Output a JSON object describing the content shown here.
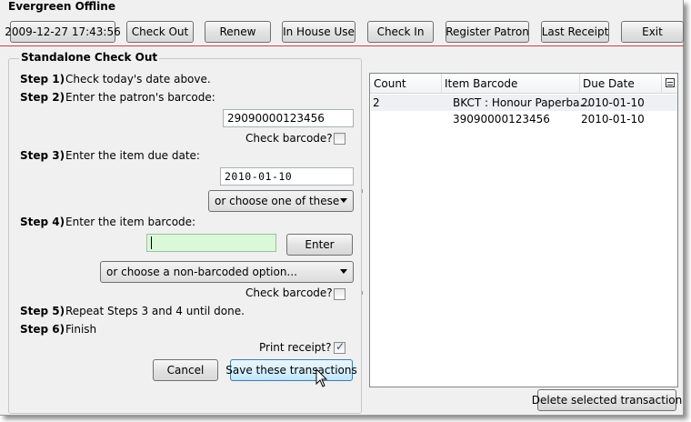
{
  "app": {
    "title": "Evergreen Offline"
  },
  "toolbar": {
    "datetime": "2009-12-27 17:43:56",
    "check_out": "Check Out",
    "renew": "Renew",
    "in_house_use": "In House Use",
    "check_in": "Check In",
    "register_patron": "Register Patron",
    "last_receipt": "Last Receipt",
    "exit": "Exit"
  },
  "form": {
    "title": "Standalone Check Out",
    "step1": {
      "label": "Step 1)",
      "text": "Check today's date above."
    },
    "step2": {
      "label": "Step 2)",
      "text": "Enter the patron's barcode:",
      "value": "29090000123456",
      "check_label": "Check barcode?"
    },
    "step3": {
      "label": "Step 3)",
      "text": "Enter the item due date:",
      "value": "2010-01-10",
      "choose_label": "or choose one of these"
    },
    "step4": {
      "label": "Step 4)",
      "text": "Enter the item barcode:",
      "value": "",
      "enter_label": "Enter",
      "nonbarcoded_label": "or choose a non-barcoded option...",
      "check_label": "Check barcode?"
    },
    "step5": {
      "label": "Step 5)",
      "text": "Repeat Steps 3 and 4 until done."
    },
    "step6": {
      "label": "Step 6)",
      "text": "Finish"
    },
    "print_receipt_label": "Print receipt?",
    "print_receipt_checked": true,
    "cancel_label": "Cancel",
    "save_label": "Save these transactions"
  },
  "transactions": {
    "columns": {
      "count": "Count",
      "item_barcode": "Item Barcode",
      "due_date": "Due Date"
    },
    "rows": [
      {
        "count": "2",
        "item_barcode": "BKCT : Honour Paperba...",
        "due_date": "2010-01-10"
      },
      {
        "count": "",
        "item_barcode": "39090000123456",
        "due_date": "2010-01-10"
      }
    ],
    "delete_label": "Delete selected transaction"
  }
}
